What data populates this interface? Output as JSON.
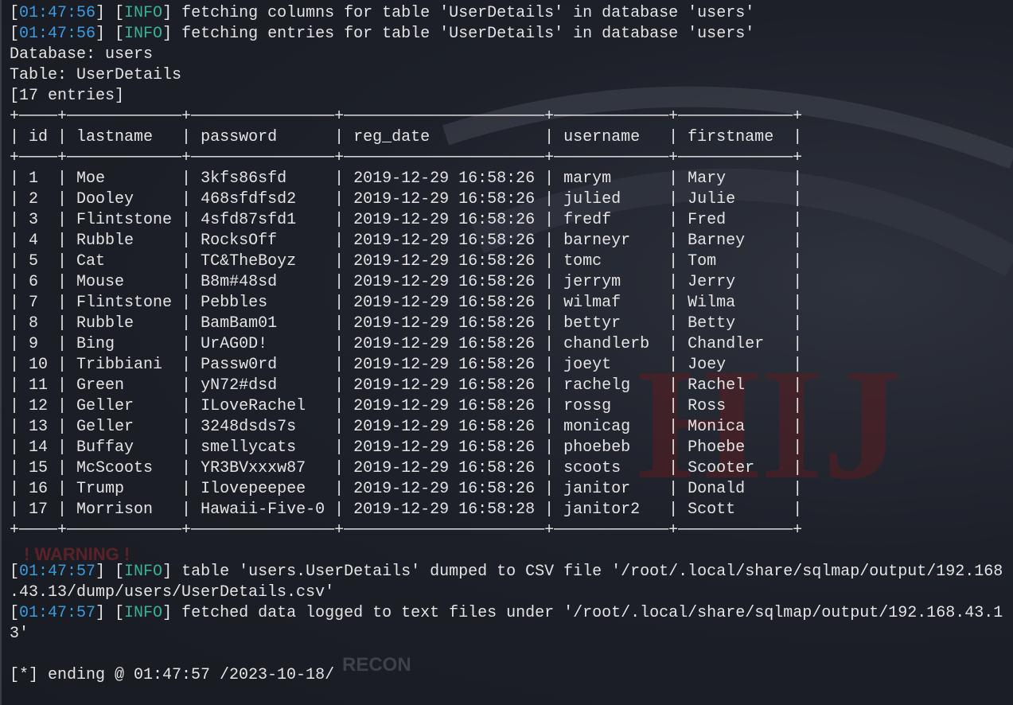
{
  "log_top": [
    {
      "time": "01:47:56",
      "level": "INFO",
      "msg": "fetching columns for table 'UserDetails' in database 'users'"
    },
    {
      "time": "01:47:56",
      "level": "INFO",
      "msg": "fetching entries for table 'UserDetails' in database 'users'"
    }
  ],
  "database_line": "Database: users",
  "table_line": "Table: UserDetails",
  "entries_line": "[17 entries]",
  "table": {
    "columns": [
      "id",
      "lastname",
      "password",
      "reg_date",
      "username",
      "firstname"
    ],
    "rows": [
      [
        "1",
        "Moe",
        "3kfs86sfd",
        "2019-12-29 16:58:26",
        "marym",
        "Mary"
      ],
      [
        "2",
        "Dooley",
        "468sfdfsd2",
        "2019-12-29 16:58:26",
        "julied",
        "Julie"
      ],
      [
        "3",
        "Flintstone",
        "4sfd87sfd1",
        "2019-12-29 16:58:26",
        "fredf",
        "Fred"
      ],
      [
        "4",
        "Rubble",
        "RocksOff",
        "2019-12-29 16:58:26",
        "barneyr",
        "Barney"
      ],
      [
        "5",
        "Cat",
        "TC&TheBoyz",
        "2019-12-29 16:58:26",
        "tomc",
        "Tom"
      ],
      [
        "6",
        "Mouse",
        "B8m#48sd",
        "2019-12-29 16:58:26",
        "jerrym",
        "Jerry"
      ],
      [
        "7",
        "Flintstone",
        "Pebbles",
        "2019-12-29 16:58:26",
        "wilmaf",
        "Wilma"
      ],
      [
        "8",
        "Rubble",
        "BamBam01",
        "2019-12-29 16:58:26",
        "bettyr",
        "Betty"
      ],
      [
        "9",
        "Bing",
        "UrAG0D!",
        "2019-12-29 16:58:26",
        "chandlerb",
        "Chandler"
      ],
      [
        "10",
        "Tribbiani",
        "Passw0rd",
        "2019-12-29 16:58:26",
        "joeyt",
        "Joey"
      ],
      [
        "11",
        "Green",
        "yN72#dsd",
        "2019-12-29 16:58:26",
        "rachelg",
        "Rachel"
      ],
      [
        "12",
        "Geller",
        "ILoveRachel",
        "2019-12-29 16:58:26",
        "rossg",
        "Ross"
      ],
      [
        "13",
        "Geller",
        "3248dsds7s",
        "2019-12-29 16:58:26",
        "monicag",
        "Monica"
      ],
      [
        "14",
        "Buffay",
        "smellycats",
        "2019-12-29 16:58:26",
        "phoebeb",
        "Phoebe"
      ],
      [
        "15",
        "McScoots",
        "YR3BVxxxw87",
        "2019-12-29 16:58:26",
        "scoots",
        "Scooter"
      ],
      [
        "16",
        "Trump",
        "Ilovepeepee",
        "2019-12-29 16:58:26",
        "janitor",
        "Donald"
      ],
      [
        "17",
        "Morrison",
        "Hawaii-Five-0",
        "2019-12-29 16:58:28",
        "janitor2",
        "Scott"
      ]
    ]
  },
  "log_bottom": [
    {
      "time": "01:47:57",
      "level": "INFO",
      "msg": "table 'users.UserDetails' dumped to CSV file '/root/.local/share/sqlmap/output/192.168",
      "cont": ".43.13/dump/users/UserDetails.csv'"
    },
    {
      "time": "01:47:57",
      "level": "INFO",
      "msg": "fetched data logged to text files under '/root/.local/share/sqlmap/output/192.168.43.1",
      "cont": "3'"
    }
  ],
  "ending_line": "[*] ending @ 01:47:57 /2023-10-18/",
  "colors": {
    "timestamp": "#3b9be0",
    "info": "#36b28f",
    "text": "#e4e4e4",
    "background": "#1d2029"
  }
}
